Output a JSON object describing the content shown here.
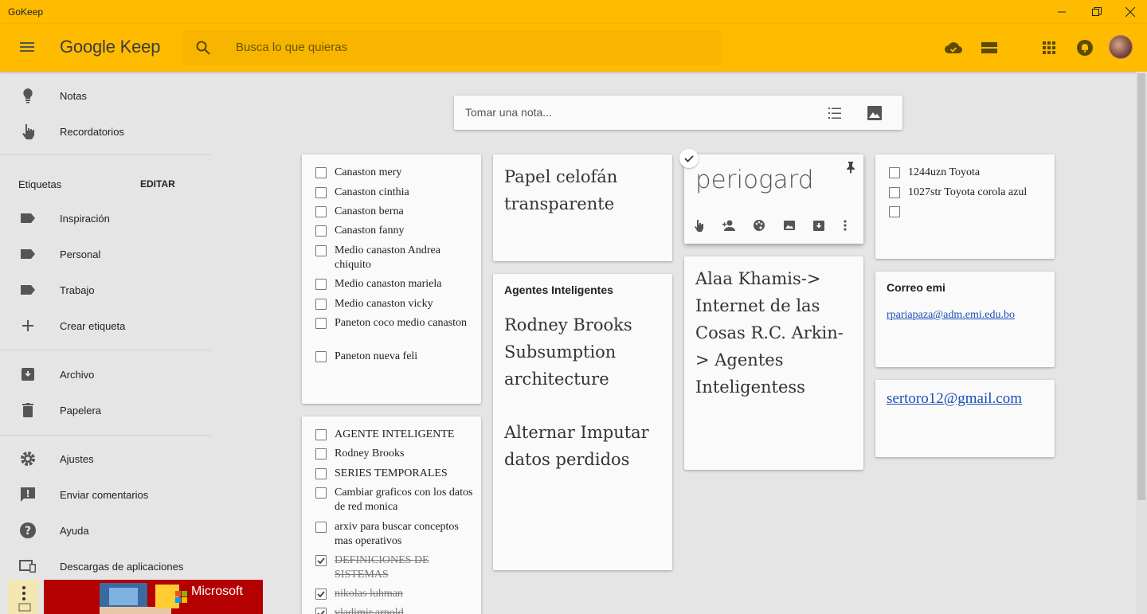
{
  "window": {
    "title": "GoKeep"
  },
  "appbar": {
    "logo": "Google Keep",
    "search_placeholder": "Busca lo que quieras",
    "accent": "#ffbb00"
  },
  "sidebar": {
    "items": [
      {
        "label": "Notas",
        "icon": "lightbulb-icon"
      },
      {
        "label": "Recordatorios",
        "icon": "reminder-hand-icon"
      }
    ],
    "labels_heading": "Etiquetas",
    "edit": "EDITAR",
    "labels": [
      {
        "label": "Inspiración"
      },
      {
        "label": "Personal"
      },
      {
        "label": "Trabajo"
      },
      {
        "label": "Crear etiqueta"
      }
    ],
    "archive": "Archivo",
    "trash": "Papelera",
    "settings": "Ajustes",
    "feedback": "Enviar comentarios",
    "help": "Ayuda",
    "downloads": "Descargas de aplicaciones"
  },
  "composer": {
    "placeholder": "Tomar una nota..."
  },
  "notes": {
    "list1": [
      "Canaston mery",
      "Canaston cinthia",
      "Canaston berna",
      "Canaston fanny",
      "Medio canaston Andrea chiquito",
      "Medio canaston mariela",
      "Medio canaston vicky",
      "Paneton coco medio canaston",
      "Paneton nueva feli"
    ],
    "list2": [
      {
        "t": "AGENTE INTELIGENTE",
        "done": false
      },
      {
        "t": "Rodney Brooks",
        "done": false
      },
      {
        "t": "SERIES TEMPORALES",
        "done": false
      },
      {
        "t": "Cambiar graficos con los datos de red monica",
        "done": false
      },
      {
        "t": "arxiv para buscar conceptos mas operativos",
        "done": false
      },
      {
        "t": "DEFINICIONES DE SISTEMAS",
        "done": true
      },
      {
        "t": "nikolas luhman",
        "done": true
      },
      {
        "t": "vladimir arnold",
        "done": true
      }
    ],
    "papel": "Papel celofán transparente",
    "agentes_title": "Agentes Inteligentes",
    "agentes_body1": "Rodney Brooks Subsumption architecture",
    "agentes_body2": "Alternar Imputar datos perdidos",
    "periogard": "periogard",
    "alaa": "Alaa Khamis-> Internet de las Cosas R.C. Arkin-> Agentes Inteligentess",
    "toyota": [
      "1244uzn Toyota",
      "1027str Toyota corola azul",
      ""
    ],
    "correo_title": "Correo emi",
    "correo_link": "rpariapaza@adm.emi.edu.bo",
    "sertoro": "sertoro12@gmail.com"
  },
  "ad": {
    "brand": "Microsoft"
  }
}
